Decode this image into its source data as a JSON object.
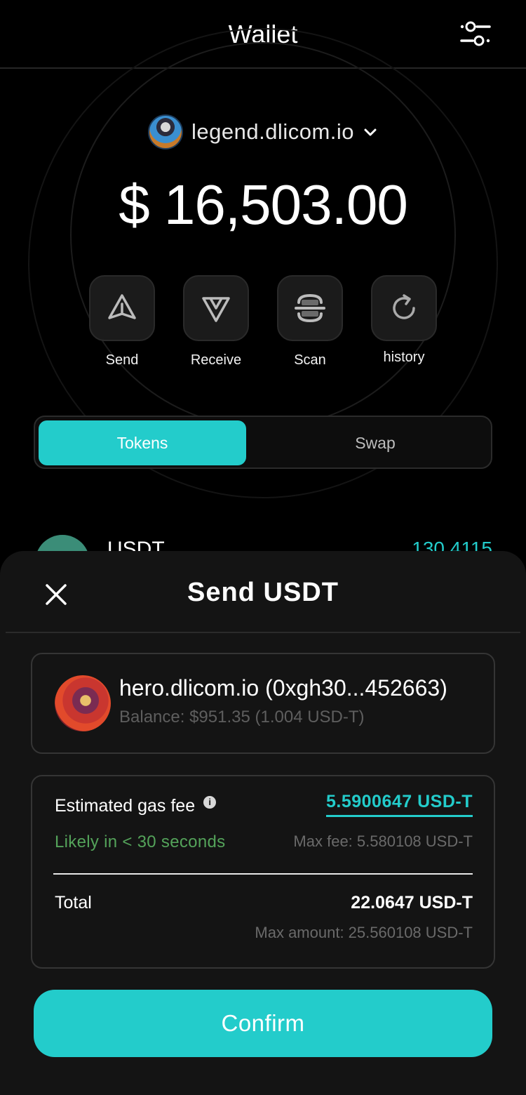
{
  "header": {
    "title": "Wallet",
    "settings_icon": "sliders-icon"
  },
  "account": {
    "name": "legend.dlicom.io",
    "avatar_icon": "user-avatar",
    "dropdown_icon": "chevron-down-icon"
  },
  "balance": "$ 16,503.00",
  "actions": [
    {
      "label": "Send",
      "icon": "send-triangle-icon"
    },
    {
      "label": "Receive",
      "icon": "receive-triangle-icon"
    },
    {
      "label": "Scan",
      "icon": "scan-icon"
    },
    {
      "label": "history",
      "icon": "refresh-icon"
    }
  ],
  "tabs": [
    {
      "label": "Tokens",
      "active": true
    },
    {
      "label": "Swap",
      "active": false
    }
  ],
  "token_list": [
    {
      "name": "USDT",
      "amount": "130.4115"
    }
  ],
  "sheet": {
    "title": "Send USDT",
    "close_icon": "close-icon",
    "recipient": {
      "name": "hero.dlicom.io (0xgh30...452663)",
      "balance": "Balance: $951.35 (1.004 USD-T)"
    },
    "fee": {
      "gas_label": "Estimated gas fee",
      "info_icon": "info-icon",
      "gas_value": "5.5900647 USD-T",
      "likely": "Likely in < 30 seconds",
      "max_fee": "Max fee: 5.580108 USD-T",
      "total_label": "Total",
      "total_value": "22.0647 USD-T",
      "max_amount": "Max amount: 25.560108 USD-T"
    },
    "confirm_label": "Confirm"
  },
  "colors": {
    "accent": "#23cccb",
    "success": "#54a35a",
    "background": "#000000",
    "sheet": "#141414"
  }
}
